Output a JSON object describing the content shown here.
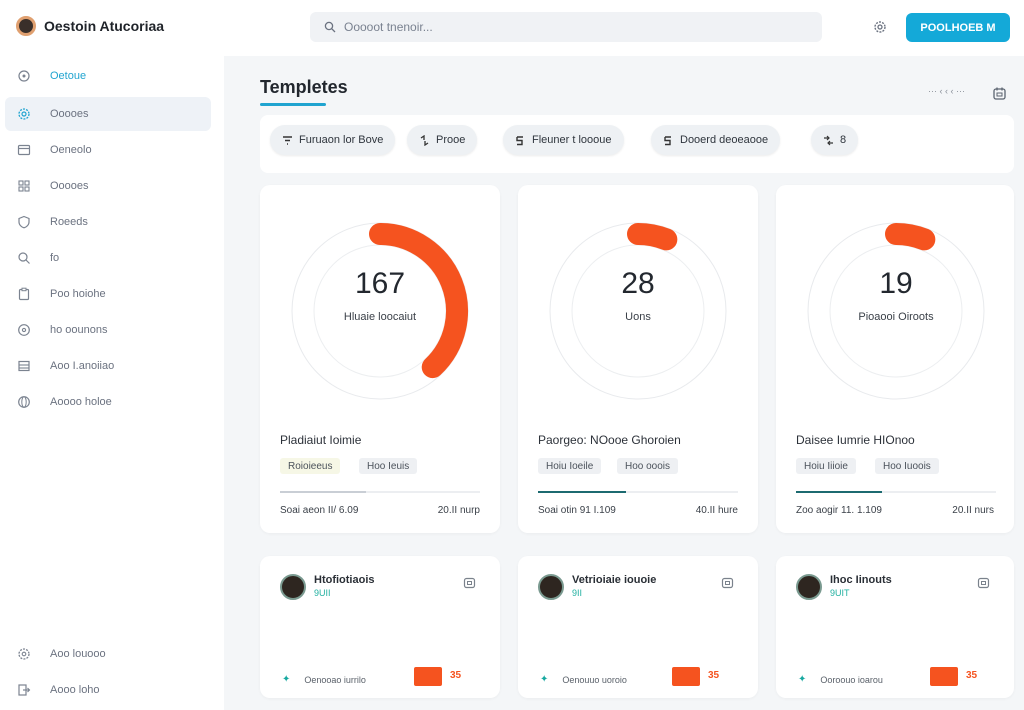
{
  "header": {
    "app_name": "Oestoin Atucoriaa",
    "search_placeholder": "Ooooot tnenoir...",
    "primary_button": "POOLHOEB M"
  },
  "sidebar": {
    "items": [
      {
        "label": "Oetoue",
        "icon": "circle-dot-icon"
      },
      {
        "label": "Ooooes",
        "icon": "gear-icon"
      },
      {
        "label": "Oeneolo",
        "icon": "window-icon"
      },
      {
        "label": "Ooooes",
        "icon": "grid-icon"
      },
      {
        "label": "Roeeds",
        "icon": "shield-icon"
      },
      {
        "label": "fo",
        "icon": "search-icon"
      },
      {
        "label": "Poo hoiohe",
        "icon": "clipboard-icon"
      },
      {
        "label": "ho oounons",
        "icon": "help-icon"
      },
      {
        "label": "Aoo I.anoiiao",
        "icon": "table-icon"
      },
      {
        "label": "Aoooo holoe",
        "icon": "globe-icon"
      }
    ],
    "bottom_items": [
      {
        "label": "Aoo louooo",
        "icon": "settings-icon"
      },
      {
        "label": "Aooo loho",
        "icon": "logout-icon"
      }
    ]
  },
  "main": {
    "title": "Templetes",
    "sort_label": "··· ‹ ‹ ‹ ···",
    "chips": [
      {
        "label": "Furuaon lor Bove",
        "icon": "filter-icon"
      },
      {
        "label": "Prooe",
        "icon": "sort-icon"
      },
      {
        "label": "Fleuner t loooue",
        "icon": "tag-icon"
      },
      {
        "label": "Dooerd deoeaooe",
        "icon": "flag-icon"
      },
      {
        "label": "8",
        "icon": "arrows-icon"
      }
    ],
    "stat_cards": [
      {
        "value": "167",
        "value_label": "Hluaie loocaiut",
        "fraction": 0.38,
        "title": "Pladiaiut Ioimie",
        "tags": [
          "Roioieeus",
          "Hoo Ieuis"
        ],
        "progress": 0.43,
        "progress_teal": false,
        "foot_left": "Soai aeon II/ 6.09",
        "foot_right": "20.II nurp"
      },
      {
        "value": "28",
        "value_label": "Uons",
        "fraction": 0.06,
        "title": "Paorgeo: NOooe Ghoroien",
        "tags": [
          "Hoiu Ioeile",
          "Hoo ooois"
        ],
        "progress": 0.44,
        "progress_teal": true,
        "foot_left": "Soai otin 91 I.109",
        "foot_right": "40.II hure"
      },
      {
        "value": "19",
        "value_label": "Pioaooi Oiroots",
        "fraction": 0.06,
        "title": "Daisee Iumrie HIOnoo",
        "tags": [
          "Hoiu Iiioie",
          "Hoo Iuoois"
        ],
        "progress": 0.43,
        "progress_teal": true,
        "foot_left": "Zoo aogir 11. 1.109",
        "foot_right": "20.II nurs"
      }
    ],
    "user_cards": [
      {
        "name": "Htofiotiaois",
        "sub": "9UII",
        "foot": "Oenooao iurrilo",
        "badge": "35"
      },
      {
        "name": "Vetrioiaie iouoie",
        "sub": "9II",
        "foot": "Oenouuo uoroio",
        "badge": "35"
      },
      {
        "name": "Ihoc Iinouts",
        "sub": "9UIT",
        "foot": "Ooroouo ioarou",
        "badge": "35"
      }
    ]
  },
  "colors": {
    "accent": "#14a9d8",
    "ring_arc": "#f5531f",
    "progress_teal": "#1c6a70"
  }
}
